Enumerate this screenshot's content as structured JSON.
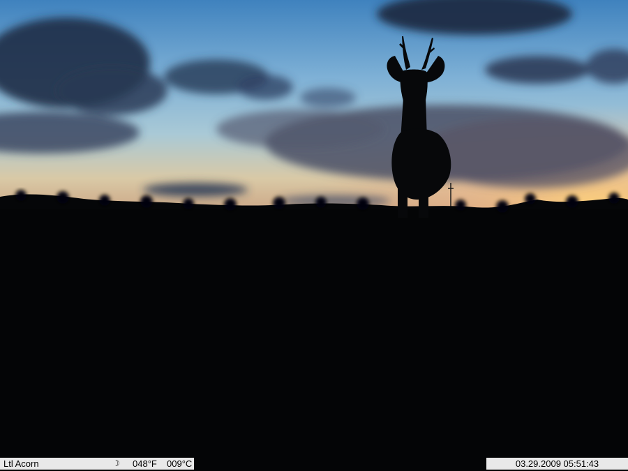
{
  "image": {
    "scene_icon": "roe-deer-silhouette-at-dusk"
  },
  "overlay": {
    "brand": "Ltl Acorn",
    "moon_phase_glyph": "☽",
    "moon_phase_icon": "waning-moon-icon",
    "temp_f": "048°F",
    "temp_c": "009°C",
    "datetime": "03.29.2009 05:51:43"
  },
  "colors": {
    "stamp_bg": "#e9e9e9",
    "stamp_text": "#000000",
    "sky_top": "#3f82be",
    "horizon_glow": "#ffd27a"
  }
}
